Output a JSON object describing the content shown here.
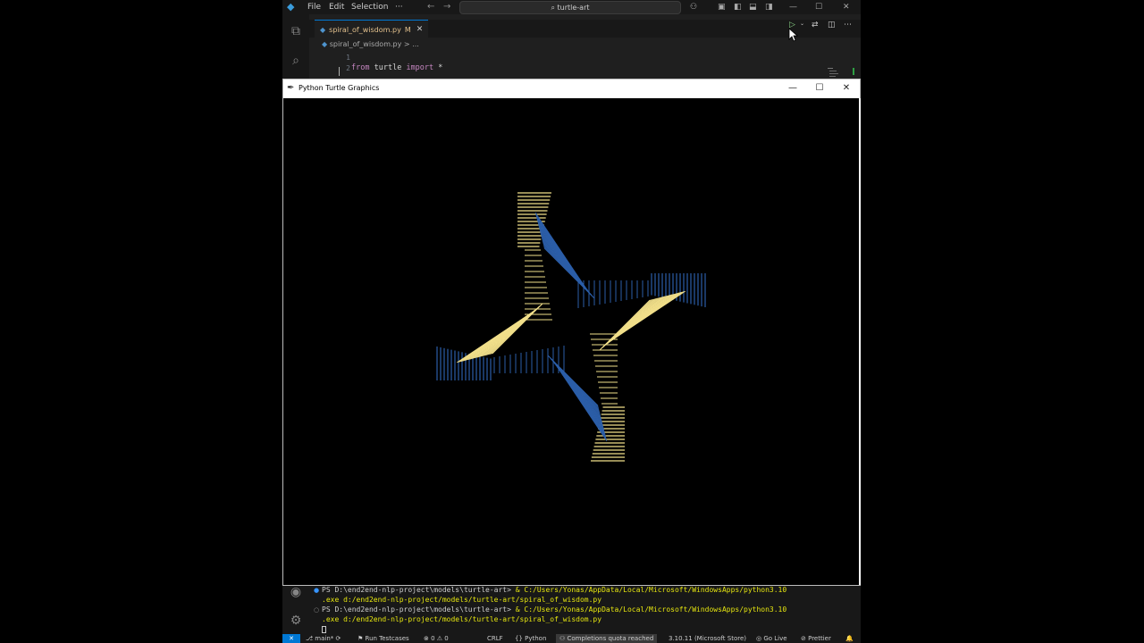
{
  "vscode": {
    "menu": [
      "File",
      "Edit",
      "Selection",
      "···"
    ],
    "command_center": "turtle-art",
    "tab": {
      "filename": "spiral_of_wisdom.py",
      "modified": "M"
    },
    "breadcrumb": {
      "file": "spiral_of_wisdom.py",
      "sep": ">",
      "more": "..."
    },
    "lines": [
      {
        "num": "1",
        "text": ""
      },
      {
        "num": "2",
        "kw1": "from",
        "mod": " turtle ",
        "kw2": "import",
        "rest": " *"
      }
    ]
  },
  "turtle_window": {
    "title": "Python Turtle Graphics",
    "colors": {
      "yellow": "#f1df8a",
      "blue": "#2c5ea8",
      "background": "#000000"
    }
  },
  "terminal": {
    "lines": [
      {
        "prompt": "PS D:\\end2end-nlp-project\\models\\turtle-art> ",
        "cmd": "& C:/Users/Yonas/AppData/Local/Microsoft/WindowsApps/python3.10"
      },
      {
        "prompt": "",
        "cmd": ".exe d:/end2end-nlp-project/models/turtle-art/spiral_of_wisdom.py"
      },
      {
        "prompt": "PS D:\\end2end-nlp-project\\models\\turtle-art> ",
        "cmd": "& C:/Users/Yonas/AppData/Local/Microsoft/WindowsApps/python3.10"
      },
      {
        "prompt": "",
        "cmd": ".exe d:/end2end-nlp-project/models/turtle-art/spiral_of_wisdom.py"
      }
    ]
  },
  "statusbar": {
    "branch": "main*",
    "run_testcases": "Run Testcases",
    "problems": "0 ⚠ 0",
    "eol": "CRLF",
    "language": "Python",
    "copilot": "Completions quota reached",
    "interpreter": "3.10.11 (Microsoft Store)",
    "golive": "Go Live",
    "prettier": "Prettier"
  }
}
